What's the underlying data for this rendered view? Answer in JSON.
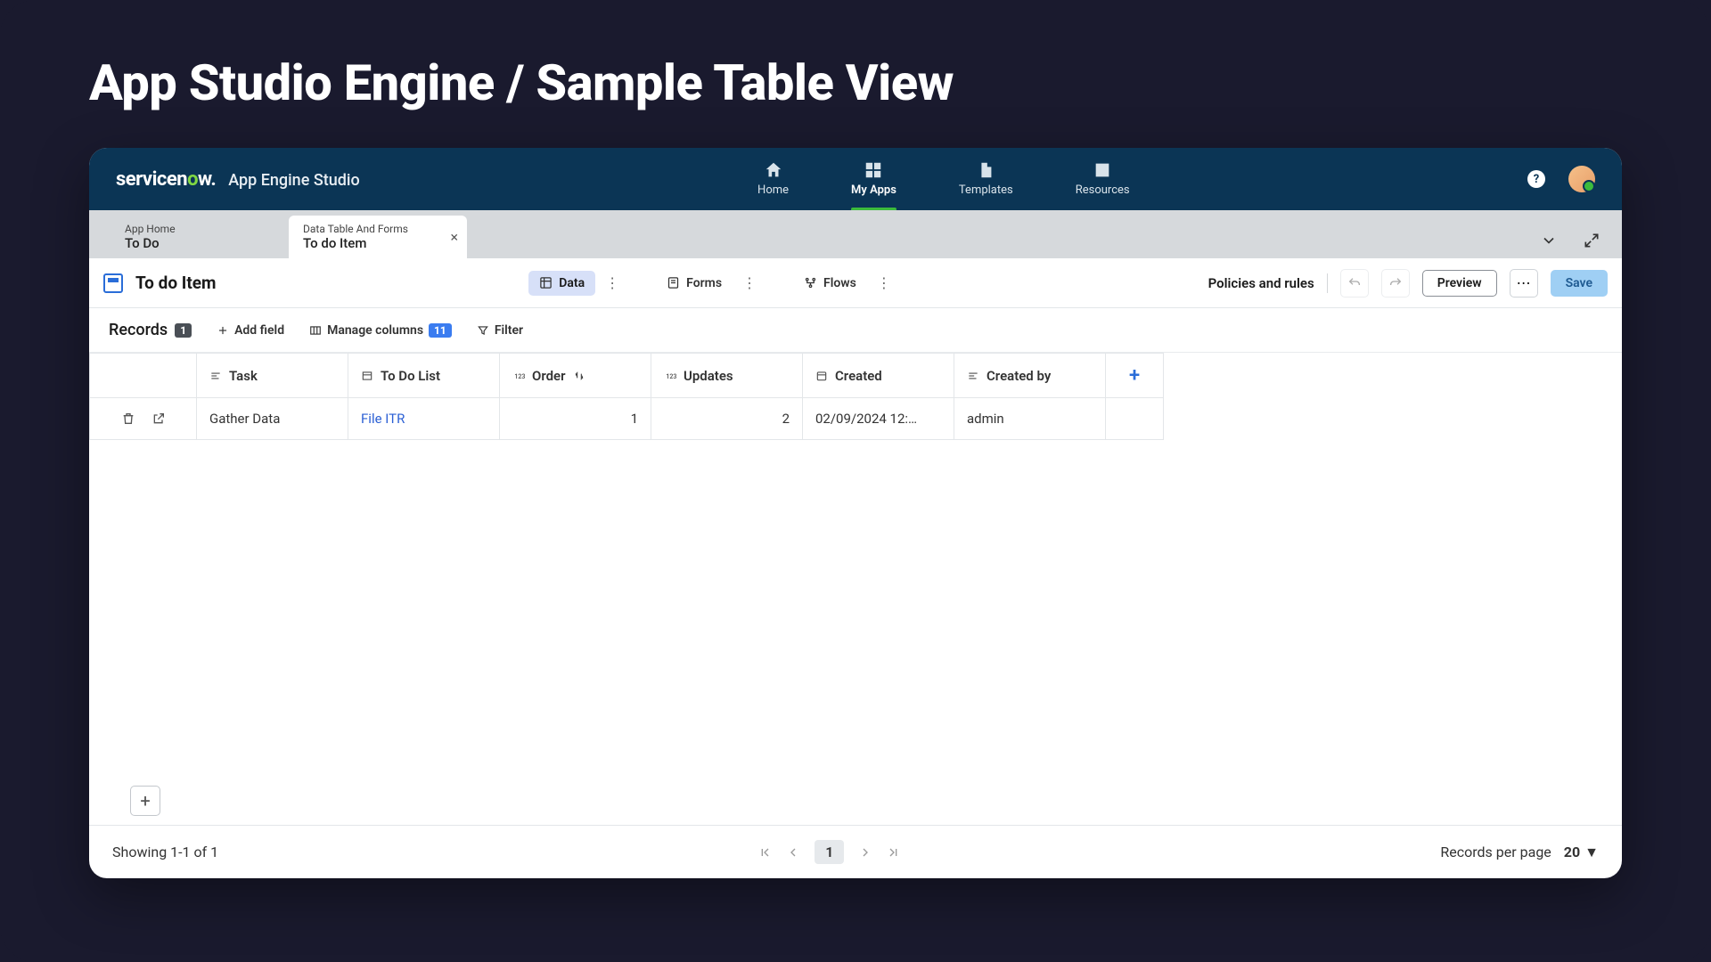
{
  "slide_title": "App Studio Engine / Sample Table View",
  "brand": {
    "logo_main": "servicen",
    "logo_accent": "o",
    "logo_end": "w.",
    "product": "App Engine Studio"
  },
  "nav": {
    "items": [
      {
        "label": "Home"
      },
      {
        "label": "My Apps"
      },
      {
        "label": "Templates"
      },
      {
        "label": "Resources"
      }
    ],
    "active_index": 1
  },
  "tabs": [
    {
      "sub": "App Home",
      "main": "To Do",
      "closable": false
    },
    {
      "sub": "Data Table And Forms",
      "main": "To do Item",
      "closable": true
    }
  ],
  "active_tab_index": 1,
  "toolbar": {
    "title": "To do Item",
    "views": [
      {
        "label": "Data",
        "icon": "grid"
      },
      {
        "label": "Forms",
        "icon": "form"
      },
      {
        "label": "Flows",
        "icon": "flow"
      }
    ],
    "active_view_index": 0,
    "policies_label": "Policies and rules",
    "preview_label": "Preview",
    "save_label": "Save"
  },
  "recordsbar": {
    "title": "Records",
    "count": "1",
    "add_field": "Add field",
    "manage_cols": "Manage columns",
    "manage_count": "11",
    "filter": "Filter"
  },
  "columns": [
    {
      "label": "Task",
      "icon": "text"
    },
    {
      "label": "To Do List",
      "icon": "ref"
    },
    {
      "label": "Order",
      "icon": "num",
      "sort": true
    },
    {
      "label": "Updates",
      "icon": "num"
    },
    {
      "label": "Created",
      "icon": "date"
    },
    {
      "label": "Created by",
      "icon": "text"
    }
  ],
  "rows": [
    {
      "task": "Gather Data",
      "list": "File ITR",
      "order": "1",
      "updates": "2",
      "created": "02/09/2024 12:…",
      "created_by": "admin"
    }
  ],
  "footer": {
    "showing": "Showing 1-1 of 1",
    "page": "1",
    "rpp_label": "Records per page",
    "rpp_value": "20"
  }
}
